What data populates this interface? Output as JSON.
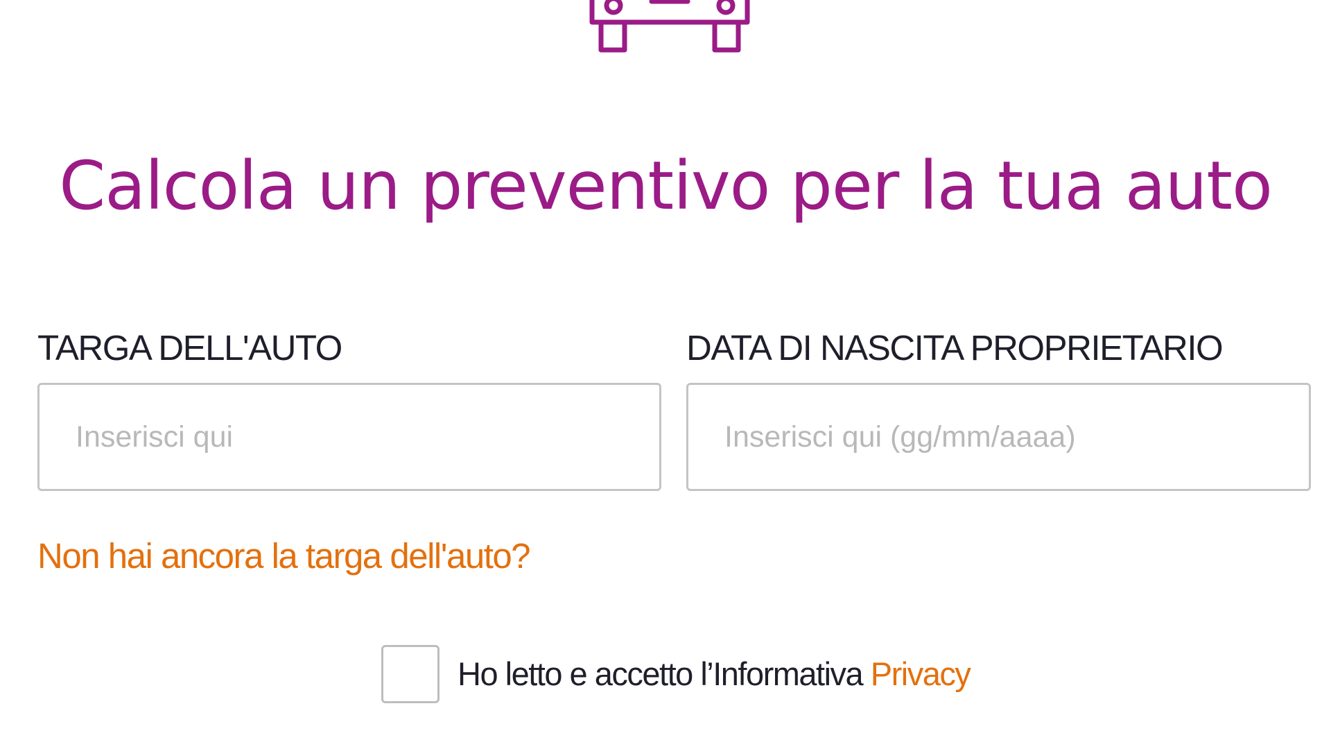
{
  "colors": {
    "brand_purple": "#9b1b87",
    "link_orange": "#e4700d",
    "text_dark": "#1f1f2b",
    "input_border": "#c4c4c4",
    "placeholder_gray": "#b8b8b8"
  },
  "header": {
    "icon": "car-icon",
    "title": "Calcola un preventivo per la tua auto"
  },
  "form": {
    "plate": {
      "label": "TARGA DELL'AUTO",
      "value": "",
      "placeholder": "Inserisci qui"
    },
    "birth_date": {
      "label": "DATA DI NASCITA PROPRIETARIO",
      "value": "",
      "placeholder": "Inserisci qui (gg/mm/aaaa)"
    },
    "no_plate_link": "Non hai ancora la targa dell'auto?"
  },
  "consent": {
    "checked": false,
    "text": "Ho letto e accetto l’Informativa ",
    "link": "Privacy"
  }
}
